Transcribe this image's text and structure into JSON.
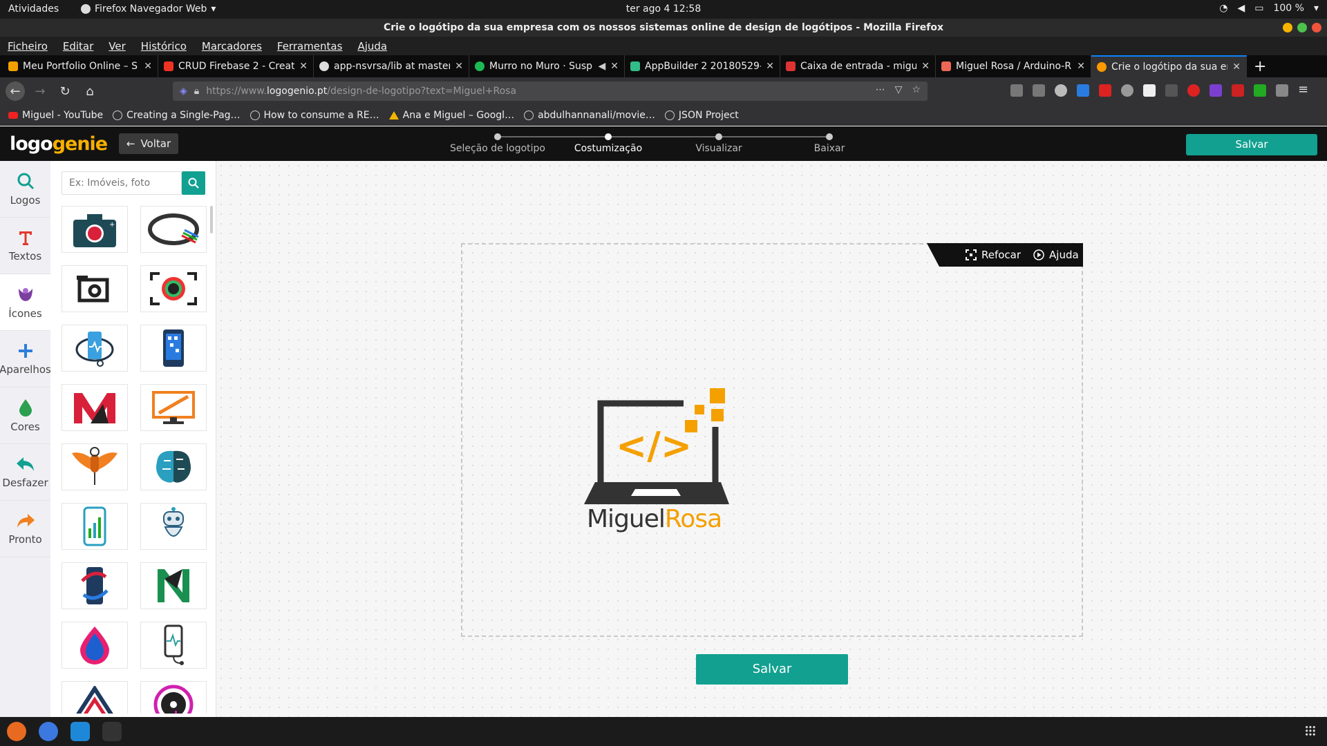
{
  "gnome": {
    "activities": "Atividades",
    "app": "Firefox Navegador Web",
    "clock": "ter ago 4  12:58",
    "battery": "100 %"
  },
  "window": {
    "title": "Crie o logótipo da sua empresa com os nossos sistemas online de design de logótipos - Mozilla Firefox"
  },
  "menu": [
    "Ficheiro",
    "Editar",
    "Ver",
    "Histórico",
    "Marcadores",
    "Ferramentas",
    "Ajuda"
  ],
  "tabs": [
    {
      "title": "Meu Portfolio Online – S",
      "color": "#f4a000"
    },
    {
      "title": "CRUD Firebase 2 - Create",
      "color": "#e32"
    },
    {
      "title": "app-nsvrsa/lib at master",
      "color": "#ddd"
    },
    {
      "title": "Murro no Muro · Suspe",
      "color": "#1db954"
    },
    {
      "title": "AppBuilder 2 20180529-",
      "color": "#3b8"
    },
    {
      "title": "Caixa de entrada - migue",
      "color": "#d33"
    },
    {
      "title": "Miguel Rosa / Arduino-R",
      "color": "#e65"
    },
    {
      "title": "Crie o logótipo da sua em",
      "color": "#f90"
    }
  ],
  "url": {
    "prefix": "https://www.",
    "host": "logogenio.pt",
    "path": "/design-de-logotipo?text=Miguel+Rosa"
  },
  "bookmarks": [
    "Miguel - YouTube",
    "Creating a Single-Pag…",
    "How to consume a RE…",
    "Ana e Miguel – Googl…",
    "abdulhannanali/movie…",
    "JSON Project"
  ],
  "app": {
    "logo_a": "logo",
    "logo_b": "genie",
    "back": "Voltar",
    "save": "Salvar",
    "steps": [
      "Seleção de logotipo",
      "Costumização",
      "Visualizar",
      "Baixar"
    ],
    "active_step": 1
  },
  "leftnav": [
    {
      "label": "Logos",
      "icon": "search-icon",
      "color": "#12a090"
    },
    {
      "label": "Textos",
      "icon": "text-icon",
      "color": "#e0392b"
    },
    {
      "label": "Ícones",
      "icon": "shapes-icon",
      "color": "#7b3fa0"
    },
    {
      "label": "Aparelhos",
      "icon": "plus-icon",
      "color": "#2e7fd9"
    },
    {
      "label": "Cores",
      "icon": "drop-icon",
      "color": "#2aa050"
    },
    {
      "label": "Desfazer",
      "icon": "undo-icon",
      "color": "#12a090"
    },
    {
      "label": "Pronto",
      "icon": "redo-icon",
      "color": "#f08020"
    }
  ],
  "search": {
    "placeholder": "Ex: Imóveis, foto"
  },
  "canvas": {
    "refocus": "Refocar",
    "help": "Ajuda",
    "brand_first": "Miguel",
    "brand_last": "Rosa",
    "save": "Salvar"
  },
  "colors": {
    "accent": "#12a090",
    "orange": "#f4a000",
    "dark": "#333333"
  }
}
